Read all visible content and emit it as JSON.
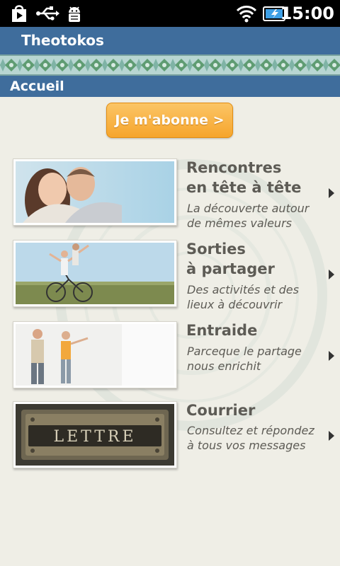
{
  "status_bar": {
    "time": "15:00",
    "icons": [
      "play-store-icon",
      "usb-icon",
      "android-debug-icon",
      "wifi-icon",
      "battery-charging-icon"
    ]
  },
  "app": {
    "title": "Theotokos",
    "section": "Accueil"
  },
  "subscribe_button": {
    "label": "Je m'abonne >"
  },
  "menu": [
    {
      "title": "Rencontres\nen tête à tête",
      "description": "La découverte autour\nde mêmes valeurs",
      "image": "couple-image"
    },
    {
      "title": "Sorties\nà partager",
      "description": "Des activités et des\nlieux à découvrir",
      "image": "bicycle-image"
    },
    {
      "title": "Entraide",
      "description": "Parceque le partage\nnous enrichit",
      "image": "people-pointing-image"
    },
    {
      "title": "Courrier",
      "description": "Consultez et répondez\nà tous vos messages",
      "image": "letter-slot-image",
      "image_text": "LETTRE"
    }
  ],
  "colors": {
    "header_blue": "#3f6d9c",
    "button_orange": "#f6a52c",
    "background": "#efeee6",
    "text_gray": "#5d5b55"
  }
}
